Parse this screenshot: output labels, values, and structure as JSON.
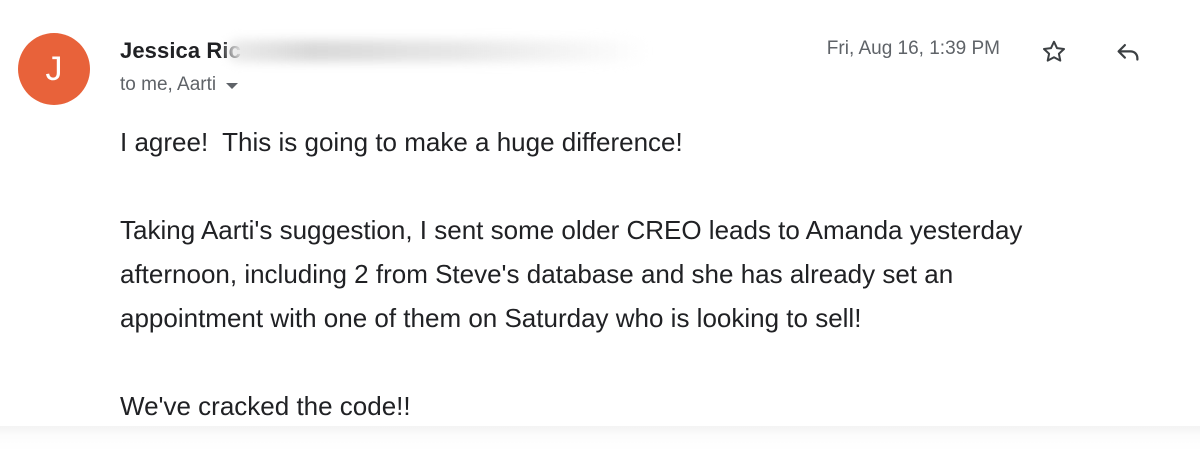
{
  "colors": {
    "avatar_bg": "#e8623a",
    "text_primary": "#202124",
    "text_secondary": "#5f6368"
  },
  "message": {
    "avatar_letter": "J",
    "sender_name": "Jessica Ric",
    "recipients": "to me, Aarti",
    "date": "Fri, Aug 16, 1:39 PM",
    "icons": {
      "star": "star-outline-icon",
      "reply": "reply-arrow-icon",
      "expand": "caret-down-icon"
    },
    "body": {
      "p1": "I agree!  This is going to make a huge difference!",
      "p2_line1": "Taking Aarti's suggestion, I sent some older CREO leads to Amanda yesterday",
      "p2_line2": "afternoon, including 2 from Steve's database and she has already set an",
      "p2_line3": "appointment with one of them on Saturday who is looking to sell!",
      "p3": "We've cracked the code!!"
    }
  }
}
